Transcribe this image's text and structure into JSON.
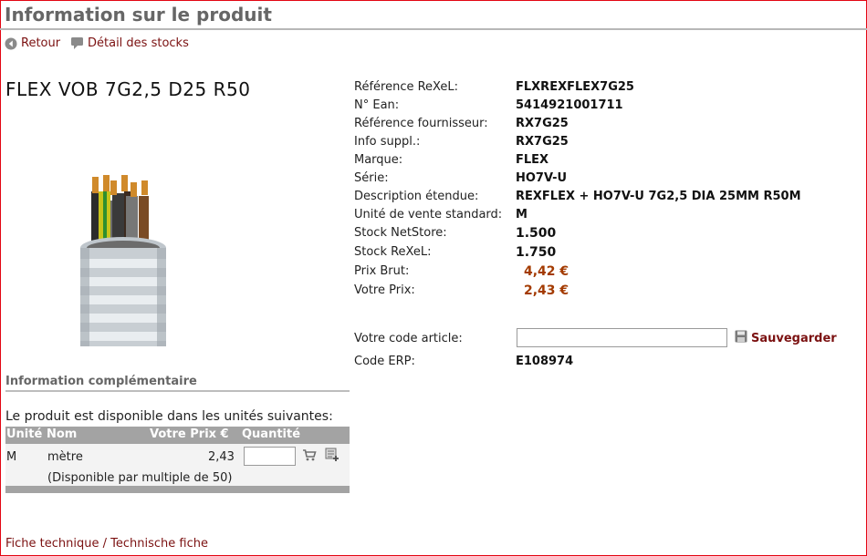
{
  "page": {
    "title": "Information sur le produit",
    "back_label": "Retour",
    "stock_detail_label": "Détail des stocks"
  },
  "product": {
    "name": "FLEX VOB 7G2,5 D25 R50"
  },
  "details": {
    "ref_rexel": {
      "label": "Référence ReXeL:",
      "value": "FLXREXFLEX7G25"
    },
    "ean": {
      "label": "N° Ean:",
      "value": "5414921001711"
    },
    "ref_supplier": {
      "label": "Référence fournisseur:",
      "value": "RX7G25"
    },
    "info_suppl": {
      "label": "Info suppl.:",
      "value": "RX7G25"
    },
    "brand": {
      "label": "Marque:",
      "value": "FLEX"
    },
    "series": {
      "label": "Série:",
      "value": "HO7V-U"
    },
    "description": {
      "label": "Description étendue:",
      "value": "REXFLEX + HO7V-U 7G2,5 DIA 25MM R50M"
    },
    "unit": {
      "label": "Unité de vente standard:",
      "value": "M"
    },
    "stock_netstore": {
      "label": "Stock NetStore:",
      "value": "1.500"
    },
    "stock_rexel": {
      "label": "Stock ReXeL:",
      "value": "1.750"
    },
    "gross_price": {
      "label": "Prix Brut:",
      "value": "4,42 €"
    },
    "your_price": {
      "label": "Votre Prix:",
      "value": "2,43 €"
    }
  },
  "article_code": {
    "label": "Votre code article:",
    "value": "",
    "save_label": "Sauvegarder"
  },
  "erp": {
    "label": "Code ERP:",
    "value": "E108974"
  },
  "complementary": {
    "title": "Information complémentaire",
    "availability_text": "Le produit est disponible dans les unités suivantes:",
    "columns": [
      "Unité",
      "Nom",
      "Votre Prix €",
      "Quantité"
    ],
    "rows": [
      {
        "unit": "M",
        "name": "mètre",
        "price": "2,43",
        "quantity": "",
        "note": "(Disponible par multiple de 50)"
      }
    ]
  },
  "footer": {
    "tech_sheet_label": "Fiche technique / Technische fiche"
  },
  "colors": {
    "border": "#e30613",
    "link": "#7b1111",
    "price": "#a33a00",
    "table_header": "#a3a3a3"
  }
}
